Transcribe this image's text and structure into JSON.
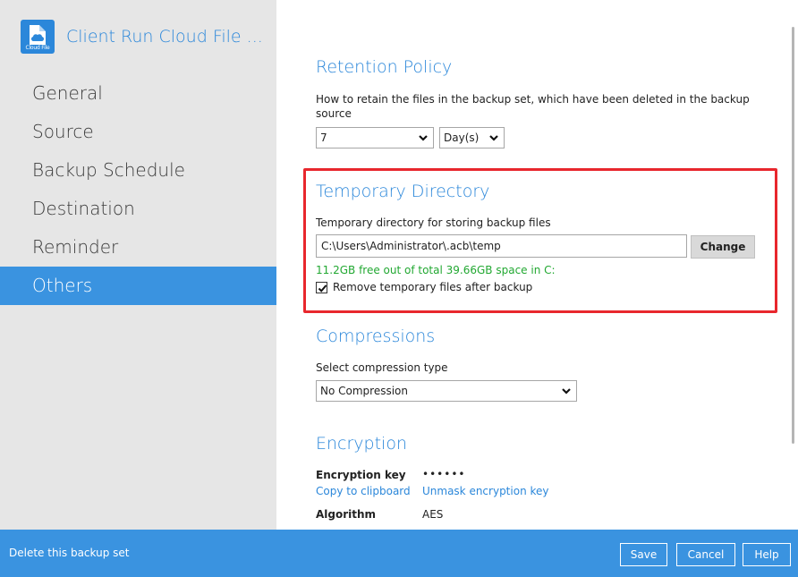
{
  "app": {
    "title": "Client Run Cloud File ...",
    "logo_text": "Cloud File"
  },
  "sidebar": {
    "items": [
      {
        "label": "General",
        "active": false
      },
      {
        "label": "Source",
        "active": false
      },
      {
        "label": "Backup Schedule",
        "active": false
      },
      {
        "label": "Destination",
        "active": false
      },
      {
        "label": "Reminder",
        "active": false
      },
      {
        "label": "Others",
        "active": true
      }
    ]
  },
  "retention": {
    "title": "Retention Policy",
    "description": "How to retain the files in the backup set, which have been deleted in the backup source",
    "value": "7",
    "unit": "Day(s)"
  },
  "temp_dir": {
    "title": "Temporary Directory",
    "label": "Temporary directory for storing backup files",
    "path": "C:\\Users\\Administrator\\.acb\\temp",
    "change_label": "Change",
    "space_info": "11.2GB free out of total 39.66GB space in C:",
    "remove_checked": true,
    "remove_label": "Remove temporary files after backup"
  },
  "compression": {
    "title": "Compressions",
    "label": "Select compression type",
    "selected": "No Compression"
  },
  "encryption": {
    "title": "Encryption",
    "key_label": "Encryption key",
    "key_value": "••••••",
    "copy_link": "Copy to clipboard",
    "unmask_link": "Unmask encryption key",
    "algorithm_label": "Algorithm",
    "algorithm_value": "AES"
  },
  "footer": {
    "delete_label": "Delete this backup set",
    "save_label": "Save",
    "cancel_label": "Cancel",
    "help_label": "Help"
  },
  "colors": {
    "accent": "#2b87da",
    "footer_bg": "#3a93e0",
    "highlight": "#e8272d",
    "success": "#22a832"
  }
}
